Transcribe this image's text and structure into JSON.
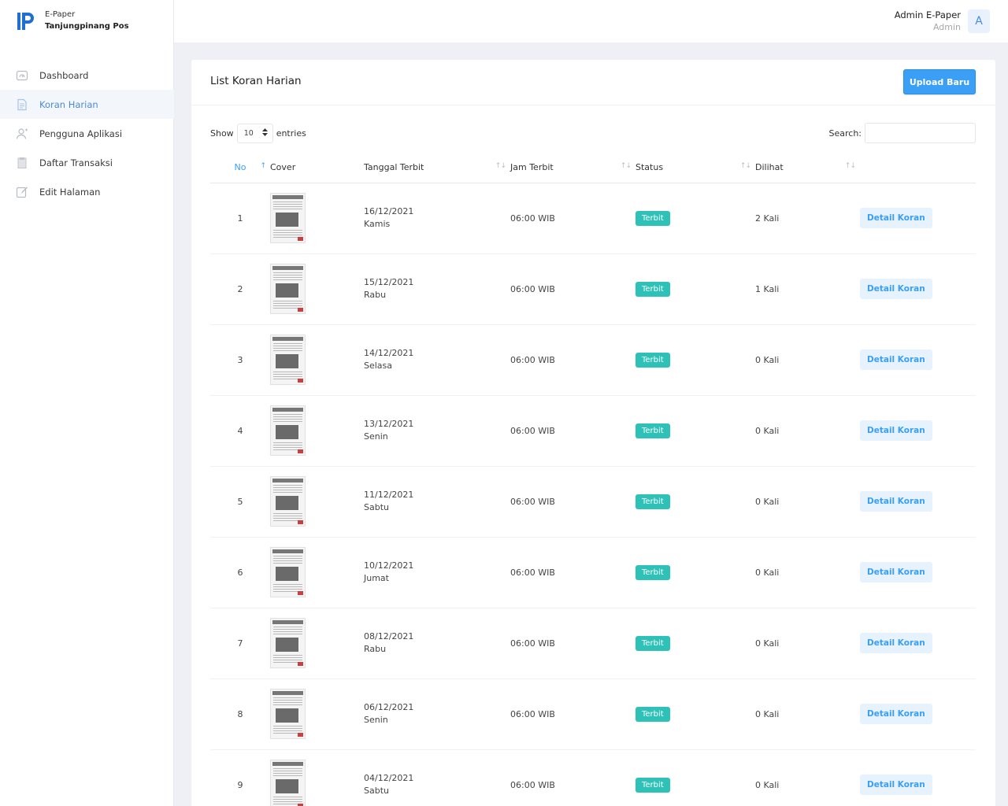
{
  "brand": {
    "line1": "E-Paper",
    "line2": "Tanjungpinang Pos"
  },
  "sidebar": {
    "items": [
      {
        "label": "Dashboard",
        "icon": "dashboard-icon"
      },
      {
        "label": "Koran Harian",
        "icon": "document-icon",
        "active": true
      },
      {
        "label": "Pengguna Aplikasi",
        "icon": "user-icon"
      },
      {
        "label": "Daftar Transaksi",
        "icon": "receipt-icon"
      },
      {
        "label": "Edit Halaman",
        "icon": "edit-icon"
      }
    ]
  },
  "user": {
    "name": "Admin E-Paper",
    "role": "Admin",
    "avatar": "A"
  },
  "card": {
    "title": "List Koran Harian",
    "upload_label": "Upload Baru"
  },
  "controls": {
    "show_label": "Show",
    "entries_value": "10",
    "entries_label": "entries",
    "search_label": "Search:"
  },
  "table": {
    "headers": [
      "No",
      "Cover",
      "Tanggal Terbit",
      "Jam Terbit",
      "Status",
      "Dilihat"
    ],
    "rows": [
      {
        "no": "1",
        "date": "16/12/2021",
        "day": "Kamis",
        "time": "06:00 WIB",
        "status": "Terbit",
        "views": "2 Kali",
        "action": "Detail Koran"
      },
      {
        "no": "2",
        "date": "15/12/2021",
        "day": "Rabu",
        "time": "06:00 WIB",
        "status": "Terbit",
        "views": "1 Kali",
        "action": "Detail Koran"
      },
      {
        "no": "3",
        "date": "14/12/2021",
        "day": "Selasa",
        "time": "06:00 WIB",
        "status": "Terbit",
        "views": "0 Kali",
        "action": "Detail Koran"
      },
      {
        "no": "4",
        "date": "13/12/2021",
        "day": "Senin",
        "time": "06:00 WIB",
        "status": "Terbit",
        "views": "0 Kali",
        "action": "Detail Koran"
      },
      {
        "no": "5",
        "date": "11/12/2021",
        "day": "Sabtu",
        "time": "06:00 WIB",
        "status": "Terbit",
        "views": "0 Kali",
        "action": "Detail Koran"
      },
      {
        "no": "6",
        "date": "10/12/2021",
        "day": "Jumat",
        "time": "06:00 WIB",
        "status": "Terbit",
        "views": "0 Kali",
        "action": "Detail Koran"
      },
      {
        "no": "7",
        "date": "08/12/2021",
        "day": "Rabu",
        "time": "06:00 WIB",
        "status": "Terbit",
        "views": "0 Kali",
        "action": "Detail Koran"
      },
      {
        "no": "8",
        "date": "06/12/2021",
        "day": "Senin",
        "time": "06:00 WIB",
        "status": "Terbit",
        "views": "0 Kali",
        "action": "Detail Koran"
      },
      {
        "no": "9",
        "date": "04/12/2021",
        "day": "Sabtu",
        "time": "06:00 WIB",
        "status": "Terbit",
        "views": "0 Kali",
        "action": "Detail Koran"
      }
    ]
  },
  "colors": {
    "accent": "#3a9ff5",
    "status_badge": "#2ec1b8",
    "active_nav": "#4a8bd6"
  }
}
